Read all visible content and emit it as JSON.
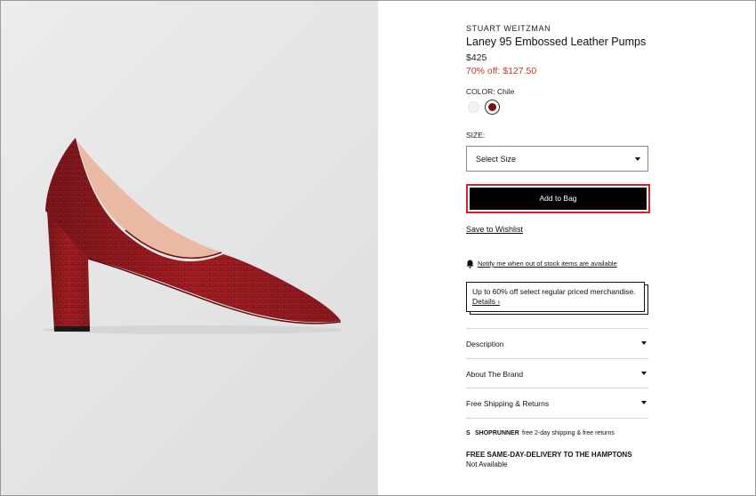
{
  "product": {
    "brand": "STUART WEITZMAN",
    "name": "Laney 95 Embossed Leather Pumps",
    "price": "$425",
    "sale_price": "70% off: $127.50",
    "image_icon": "red-pump-shoe-image"
  },
  "color": {
    "label": "COLOR: Chile",
    "swatches": [
      "#f2f2f2",
      "#7a0f14"
    ],
    "selected_index": 1
  },
  "size": {
    "label": "SIZE:",
    "select_value": "Select Size"
  },
  "actions": {
    "add_to_bag": "Add to Bag",
    "wishlist": "Save to Wishlist",
    "notify": "Notify me when out of stock items are available"
  },
  "promo": {
    "text": "Up to 60% off select regular priced merchandise.",
    "link": "Details ›"
  },
  "accordion": [
    {
      "label": "Description"
    },
    {
      "label": "About The Brand"
    },
    {
      "label": "Free Shipping & Returns"
    }
  ],
  "shoprunner": {
    "logo": "S",
    "brand": "SHOPRUNNER",
    "text": "free 2-day shipping & free returns"
  },
  "same_day": {
    "title": "FREE SAME-DAY-DELIVERY TO THE HAMPTONS",
    "status": "Not Available"
  },
  "colors": {
    "accent_outline": "#d8202a",
    "sale_red": "#c0392b",
    "button_bg": "#000000"
  }
}
